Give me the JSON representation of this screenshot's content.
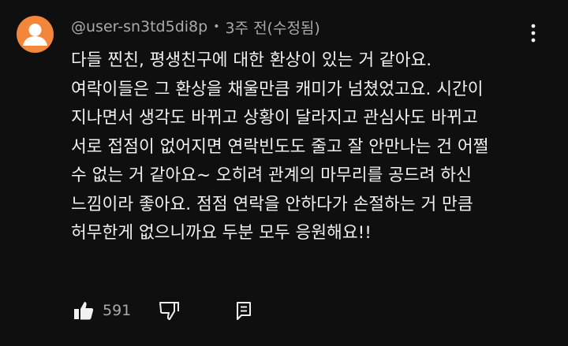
{
  "comment": {
    "author": "@user-sn3td5di8p",
    "separator": "•",
    "time": "3주 전(수정됨)",
    "lines": [
      "다들 찐친, 평생친구에 대한 환상이 있는 거 같아요.",
      "여락이들은 그 환상을 채울만큼 캐미가 넘쳤었고요. 시간이",
      "지나면서 생각도 바뀌고 상황이 달라지고 관심사도 바뀌고",
      "서로 접점이 없어지면 연락빈도도 줄고 잘 안만나는 건 어쩔",
      "수 없는 거 같아요~ 오히려 관계의 마무리를 공드려 하신",
      "느낌이라 좋아요. 점점 연락을 안하다가 손절하는 거 만큼",
      "허무한게 없으니까요 두분 모두 응원해요!!"
    ],
    "like_count": "591"
  },
  "icons": {
    "avatar": "default-avatar-icon",
    "menu": "more-vertical-icon",
    "like": "thumbs-up-filled-icon",
    "dislike": "thumbs-down-outline-icon",
    "reply": "comment-reply-icon"
  },
  "colors": {
    "background": "#0f0f0f",
    "text": "#f1f1f1",
    "secondary_text": "#aaaaaa",
    "avatar_bg": "#f4863b"
  }
}
